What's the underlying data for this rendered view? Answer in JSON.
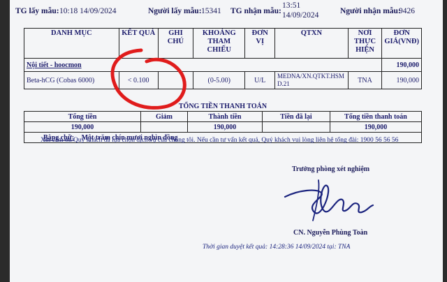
{
  "header": {
    "collect_time_label": "TG lấy mẫu:",
    "collect_time": "10:18 14/09/2024",
    "collector_label": "Người lấy mẫu:",
    "collector": "15341",
    "receive_time_label": "TG nhận mẫu:",
    "receive_time_1": "13:51",
    "receive_time_2": "14/09/2024",
    "receiver_label": "Người nhận mẫu:",
    "receiver": "9426"
  },
  "table": {
    "headers": [
      "DANH MỤC",
      "KẾT QUẢ",
      "GHI CHÚ",
      "KHOẢNG THAM CHIẾU",
      "ĐƠN VỊ",
      "QTXN",
      "NƠI THỰC HIỆN",
      "ĐƠN GIÁ(VNĐ)"
    ],
    "group": {
      "name": "Nội tiết - hoocmon",
      "price": "190,000"
    },
    "rows": [
      {
        "name": "Beta-hCG (Cobas 6000)",
        "result": "< 0.100",
        "note": "",
        "range": "(0-5.00)",
        "unit": "U/L",
        "qtxn": "MEDNA/XN.QTKT.HSMD.21",
        "place": "TNA",
        "price": "190,000"
      }
    ]
  },
  "payment": {
    "title": "TỔNG TIỀN THANH TOÁN",
    "headers": [
      "Tổng tiền",
      "Giảm",
      "Thành tiền",
      "Tiền đã lại",
      "Tổng tiền thanh toán"
    ],
    "values": [
      "190,000",
      "",
      "190,000",
      "",
      "190,000"
    ],
    "in_words_label": "Bằng chữ:",
    "in_words": "Một trăm chín mươi nghìn đồng"
  },
  "thanks": "Xin cảm ơn Quý khách đã lựa chọn dịch vụ của chúng tôi. Nếu cần tư vấn kết quả, Quý khách vui lòng liên hệ tổng đài: 1900 56 56 56",
  "signature": {
    "title": "Trưởng phòng xét nghiệm",
    "name": "CN. Nguyễn Phùng Toàn",
    "approval": "Thời gian duyệt kết quả: 14:28:36 14/09/2024    tại: TNA"
  },
  "colors": {
    "ink": "#1a237e",
    "red_mark": "#e01c1c",
    "background": "#2b2b2b"
  }
}
